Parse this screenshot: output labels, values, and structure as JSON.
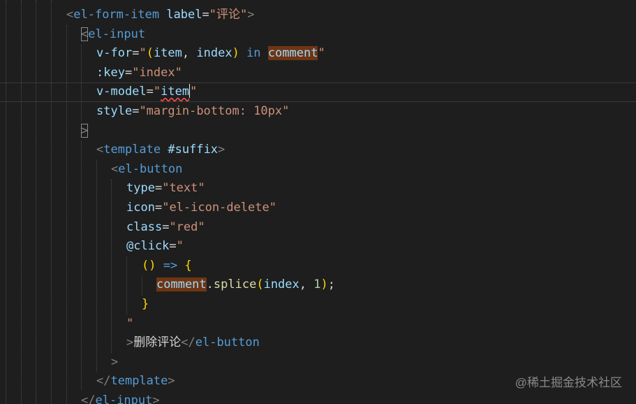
{
  "lines": [
    {
      "tokens": [
        {
          "t": "<",
          "c": "punc"
        },
        {
          "t": "el-form-item",
          "c": "tag"
        },
        {
          "t": " ",
          "c": "def"
        },
        {
          "t": "label",
          "c": "attr"
        },
        {
          "t": "=",
          "c": "def"
        },
        {
          "t": "\"评论\"",
          "c": "str"
        },
        {
          "t": ">",
          "c": "punc"
        }
      ]
    },
    {
      "tokens": [
        {
          "t": "<",
          "c": "punc",
          "box": true
        },
        {
          "t": "el-input",
          "c": "tag"
        }
      ]
    },
    {
      "tokens": [
        {
          "t": "v-for",
          "c": "attr"
        },
        {
          "t": "=",
          "c": "def"
        },
        {
          "t": "\"",
          "c": "str"
        },
        {
          "t": "(",
          "c": "br"
        },
        {
          "t": "item",
          "c": "attr"
        },
        {
          "t": ", ",
          "c": "def"
        },
        {
          "t": "index",
          "c": "attr"
        },
        {
          "t": ")",
          "c": "br"
        },
        {
          "t": " ",
          "c": "def"
        },
        {
          "t": "in",
          "c": "kw"
        },
        {
          "t": " ",
          "c": "def"
        },
        {
          "t": "comment",
          "c": "attr",
          "hl": true
        },
        {
          "t": "\"",
          "c": "str"
        }
      ]
    },
    {
      "tokens": [
        {
          "t": ":key",
          "c": "attr"
        },
        {
          "t": "=",
          "c": "def"
        },
        {
          "t": "\"index\"",
          "c": "str"
        }
      ]
    },
    {
      "tokens": [
        {
          "t": "v-model",
          "c": "attr"
        },
        {
          "t": "=",
          "c": "def"
        },
        {
          "t": "\"",
          "c": "str"
        },
        {
          "t": "item",
          "c": "attr",
          "squiggle": true
        },
        {
          "t": "",
          "c": "def",
          "cursor": true
        },
        {
          "t": "\"",
          "c": "str"
        }
      ]
    },
    {
      "tokens": [
        {
          "t": "style",
          "c": "attr"
        },
        {
          "t": "=",
          "c": "def"
        },
        {
          "t": "\"margin-bottom: 10px\"",
          "c": "str"
        }
      ]
    },
    {
      "tokens": [
        {
          "t": ">",
          "c": "punc",
          "box": true
        }
      ]
    },
    {
      "tokens": [
        {
          "t": "<",
          "c": "punc"
        },
        {
          "t": "template",
          "c": "tag"
        },
        {
          "t": " ",
          "c": "def"
        },
        {
          "t": "#suffix",
          "c": "attr"
        },
        {
          "t": ">",
          "c": "punc"
        }
      ]
    },
    {
      "tokens": [
        {
          "t": "<",
          "c": "punc"
        },
        {
          "t": "el-button",
          "c": "tag"
        }
      ]
    },
    {
      "tokens": [
        {
          "t": "type",
          "c": "attr"
        },
        {
          "t": "=",
          "c": "def"
        },
        {
          "t": "\"text\"",
          "c": "str"
        }
      ]
    },
    {
      "tokens": [
        {
          "t": "icon",
          "c": "attr"
        },
        {
          "t": "=",
          "c": "def"
        },
        {
          "t": "\"el-icon-delete\"",
          "c": "str"
        }
      ]
    },
    {
      "tokens": [
        {
          "t": "class",
          "c": "attr"
        },
        {
          "t": "=",
          "c": "def"
        },
        {
          "t": "\"red\"",
          "c": "str"
        }
      ]
    },
    {
      "tokens": [
        {
          "t": "@click",
          "c": "attr"
        },
        {
          "t": "=",
          "c": "def"
        },
        {
          "t": "\"",
          "c": "str"
        }
      ]
    },
    {
      "tokens": [
        {
          "t": "()",
          "c": "br"
        },
        {
          "t": " ",
          "c": "def"
        },
        {
          "t": "=>",
          "c": "kw"
        },
        {
          "t": " ",
          "c": "def"
        },
        {
          "t": "{",
          "c": "br"
        }
      ]
    },
    {
      "tokens": [
        {
          "t": "comment",
          "c": "attr",
          "hl": true
        },
        {
          "t": ".",
          "c": "def"
        },
        {
          "t": "splice",
          "c": "fn"
        },
        {
          "t": "(",
          "c": "br"
        },
        {
          "t": "index",
          "c": "attr"
        },
        {
          "t": ", ",
          "c": "def"
        },
        {
          "t": "1",
          "c": "num"
        },
        {
          "t": ")",
          "c": "br"
        },
        {
          "t": ";",
          "c": "def"
        }
      ]
    },
    {
      "tokens": [
        {
          "t": "}",
          "c": "br"
        }
      ]
    },
    {
      "tokens": [
        {
          "t": "\"",
          "c": "str"
        }
      ]
    },
    {
      "tokens": [
        {
          "t": ">",
          "c": "punc"
        },
        {
          "t": "删除评论",
          "c": "def"
        },
        {
          "t": "</",
          "c": "punc"
        },
        {
          "t": "el-button",
          "c": "tag"
        }
      ]
    },
    {
      "tokens": [
        {
          "t": ">",
          "c": "punc"
        }
      ]
    },
    {
      "tokens": [
        {
          "t": "</",
          "c": "punc"
        },
        {
          "t": "template",
          "c": "tag"
        },
        {
          "t": ">",
          "c": "punc"
        }
      ]
    },
    {
      "tokens": [
        {
          "t": "</",
          "c": "punc"
        },
        {
          "t": "el-input",
          "c": "tag"
        },
        {
          "t": ">",
          "c": "punc"
        }
      ]
    }
  ],
  "watermark": "@稀土掘金技术社区",
  "colors": {
    "background": "#1e1e1e",
    "tag": "#569cd6",
    "attribute": "#9cdcfe",
    "string": "#ce9178",
    "punctuation": "#808080",
    "bracket": "#ffd700",
    "number": "#b5cea8",
    "function": "#dcdcaa",
    "highlight": "#6f3513",
    "error_squiggle": "#f14c4c"
  }
}
